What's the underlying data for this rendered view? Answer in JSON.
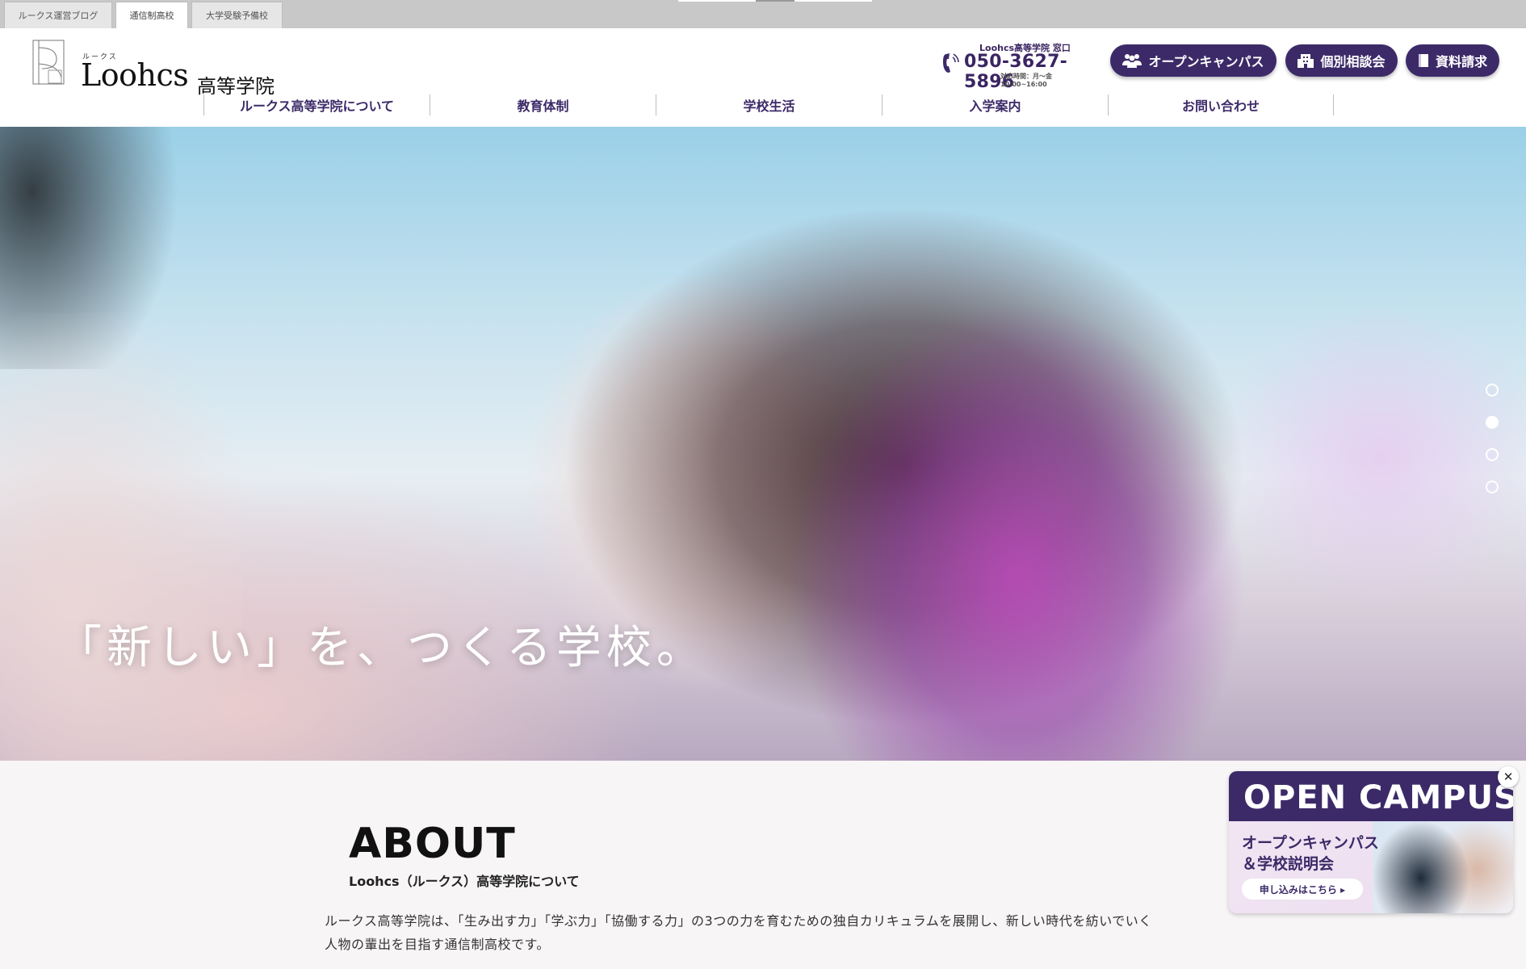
{
  "top_tabs": [
    {
      "label": "ルークス運営ブログ",
      "active": false
    },
    {
      "label": "通信制高校",
      "active": true
    },
    {
      "label": "大学受験予備校",
      "active": false
    }
  ],
  "logo": {
    "ruby": "ルークス",
    "name": "Loohcs",
    "sub": "高等学院"
  },
  "contact": {
    "window": "Loohcs高等学院 窓口",
    "phone": "050-3627-5896",
    "hours": "対応時間：月～金 10:00~16:00"
  },
  "header_buttons": {
    "open_campus": "オープンキャンパス",
    "consult": "個別相談会",
    "request": "資料請求"
  },
  "nav": [
    "ルークス高等学院について",
    "教育体制",
    "学校生活",
    "入学案内",
    "お問い合わせ"
  ],
  "hero": {
    "tagline": "「新しい」を、つくる学校。",
    "slide_count": 4,
    "active_slide": 2
  },
  "about": {
    "title": "ABOUT",
    "subtitle": "Loohcs（ルークス）高等学院について",
    "body_line1": "ルークス高等学院は、「生み出す力」「学ぶ力」「協働する力」の3つの力を育むための独自カリキュラムを展開し、新しい時代を紡いでいく",
    "body_line2": "人物の輩出を目指す通信制高校です。"
  },
  "banner": {
    "title": "OPEN CAMPUS",
    "line1": "オープンキャンパス",
    "line2": "＆学校説明会",
    "apply": "申し込みはこちら ▸",
    "close": "✕"
  },
  "colors": {
    "brand": "#3c2a68",
    "background": "#f7f5f6"
  }
}
